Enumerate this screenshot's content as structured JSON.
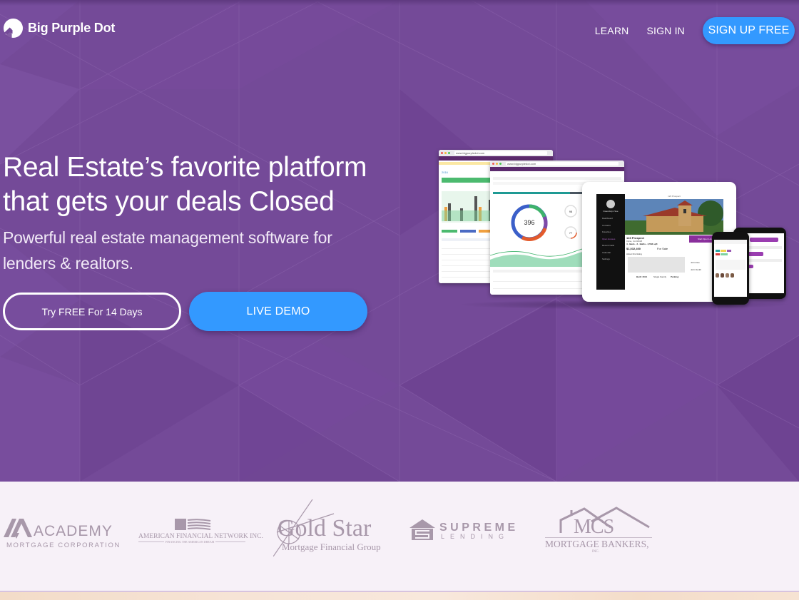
{
  "brand": {
    "name": "Big Purple Dot",
    "logo_icon": "house-in-circle-icon"
  },
  "nav": {
    "links": [
      {
        "label": "LEARN"
      },
      {
        "label": "SIGN IN"
      }
    ],
    "signup_label": "SIGN UP FREE"
  },
  "hero": {
    "headline_line1": "Real Estate’s favorite platform",
    "headline_line2": "that gets your deals Closed",
    "subhead_line1": "Powerful real estate management software for",
    "subhead_line2": "lenders & realtors.",
    "cta_trial_label": "Try FREE For 14 Days",
    "cta_demo_label": "LIVE DEMO"
  },
  "mockup": {
    "browser_url": "www.bigpurpledot.com",
    "dashboard_year": "2016",
    "donut_value": "396",
    "small_gauge_1": "98",
    "small_gauge_2": "77",
    "listing_header": "123 Prospect",
    "listing_title": "123 Prospect",
    "listing_city": "Irvine, CA 92618",
    "listing_specs": "4 · Beds · 3 · Baths · 2,563 sqft",
    "listing_price": "$1,032,400",
    "listing_status": "For Sale",
    "listing_button": "Start Open House",
    "about_label": "About this listing",
    "built": "Built: 2014",
    "type": "Single Family",
    "parking": "Parking:",
    "visitors": [
      "John Doe",
      "John Smith"
    ],
    "agent_name": "Gwendolyn Sue",
    "sidebar_items": [
      "Dashboard",
      "Contacts",
      "Favorites",
      "Open Houses",
      "Recent Calls",
      "Calendar",
      "Settings"
    ]
  },
  "colors": {
    "hero_purple": "#744a98",
    "accent_blue": "#3399ff",
    "partner_gray": "#a898aa",
    "partners_bg": "#f7f1f8"
  },
  "partners": [
    {
      "name": "ACADEMY",
      "sub": "MORTGAGE CORPORATION"
    },
    {
      "name": "AMERICAN FINANCIAL NETWORK INC.",
      "sub": "FINANCING THE AMERICAN DREAM"
    },
    {
      "name": "Gold Star",
      "sub": "Mortgage Financial Group"
    },
    {
      "name": "SUPREME",
      "sub": "LENDING"
    },
    {
      "name": "MCS",
      "sub": "MORTGAGE BANKERS,",
      "sub2": "INC."
    }
  ]
}
